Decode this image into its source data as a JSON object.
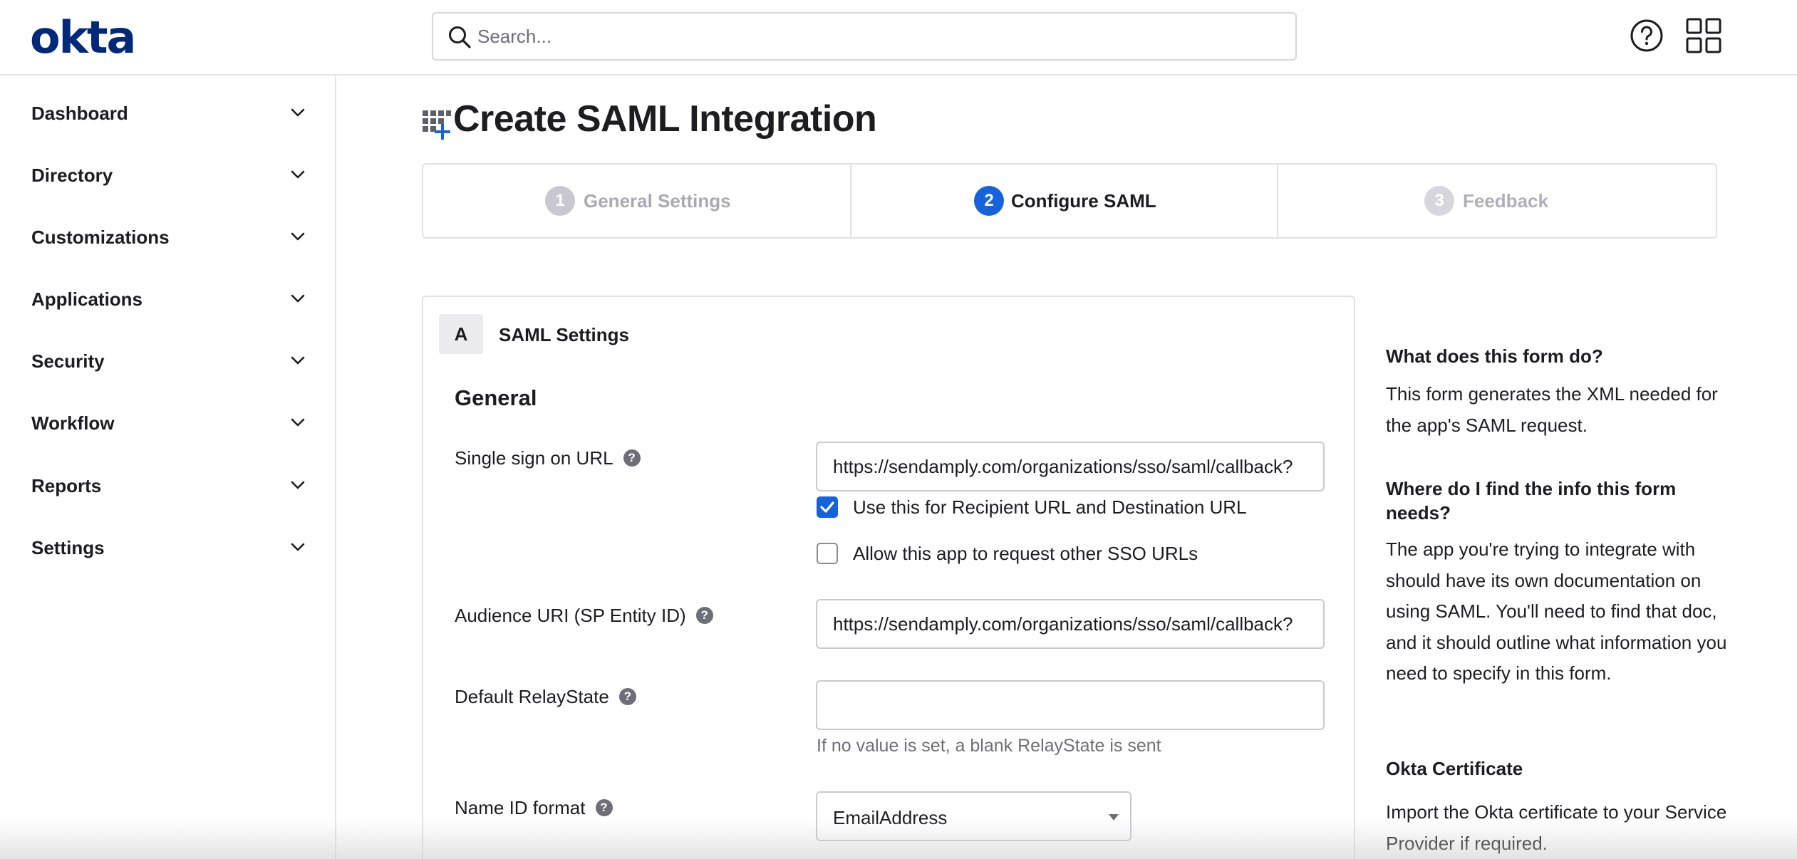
{
  "header": {
    "logo_text": "okta",
    "search_placeholder": "Search...",
    "help_icon": "help-circle-icon",
    "apps_icon": "app-grid-icon"
  },
  "sidebar": {
    "items": [
      {
        "label": "Dashboard",
        "icon": "chevron-down-icon"
      },
      {
        "label": "Directory",
        "icon": "chevron-down-icon"
      },
      {
        "label": "Customizations",
        "icon": "chevron-down-icon"
      },
      {
        "label": "Applications",
        "icon": "chevron-down-icon"
      },
      {
        "label": "Security",
        "icon": "chevron-down-icon"
      },
      {
        "label": "Workflow",
        "icon": "chevron-down-icon"
      },
      {
        "label": "Reports",
        "icon": "chevron-down-icon"
      },
      {
        "label": "Settings",
        "icon": "chevron-down-icon"
      }
    ]
  },
  "page": {
    "title": "Create SAML Integration",
    "title_icon": "app-add-icon"
  },
  "stepper": {
    "steps": [
      {
        "number": "1",
        "label": "General Settings",
        "state": "complete"
      },
      {
        "number": "2",
        "label": "Configure SAML",
        "state": "active"
      },
      {
        "number": "3",
        "label": "Feedback",
        "state": "upcoming"
      }
    ]
  },
  "saml_card": {
    "badge": "A",
    "title": "SAML Settings",
    "section_title": "General",
    "fields": {
      "sso_url": {
        "label": "Single sign on URL",
        "value": "https://sendamply.com/organizations/sso/saml/callback?",
        "recipient_checkbox_label": "Use this for Recipient URL and Destination URL",
        "recipient_checked": true,
        "allow_other_label": "Allow this app to request other SSO URLs",
        "allow_other_checked": false
      },
      "audience_uri": {
        "label": "Audience URI (SP Entity ID)",
        "value": "https://sendamply.com/organizations/sso/saml/callback?"
      },
      "relay_state": {
        "label": "Default RelayState",
        "value": "",
        "hint": "If no value is set, a blank RelayState is sent"
      },
      "name_id_format": {
        "label": "Name ID format",
        "selected": "EmailAddress"
      }
    },
    "help_glyph": "?"
  },
  "help_panel": {
    "q1": "What does this form do?",
    "a1": "This form generates the XML needed for the app's SAML request.",
    "q2": "Where do I find the info this form needs?",
    "a2": "The app you're trying to integrate with should have its own documentation on using SAML. You'll need to find that doc, and it should outline what information you need to specify in this form.",
    "q3": "Okta Certificate",
    "a3": "Import the Okta certificate to your Service Provider if required."
  },
  "colors": {
    "brand": "#00297a",
    "accent": "#1662dd",
    "muted": "#b0b0b8",
    "text": "#1d1d21"
  }
}
